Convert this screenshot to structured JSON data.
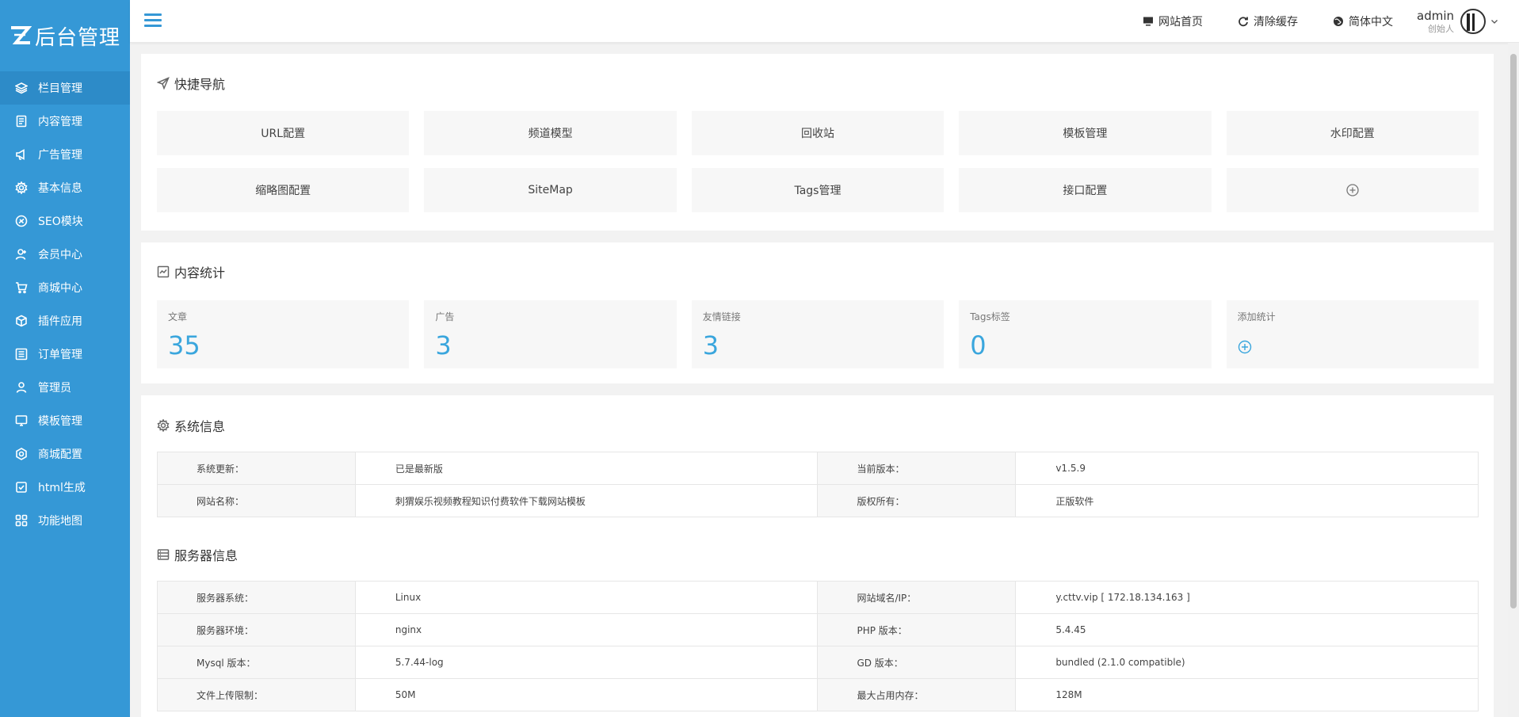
{
  "app": {
    "logo_text": "后台管理",
    "logo_mark": "Z"
  },
  "sidebar": {
    "items": [
      {
        "label": "栏目管理",
        "icon": "layers-icon",
        "active": true
      },
      {
        "label": "内容管理",
        "icon": "document-icon"
      },
      {
        "label": "广告管理",
        "icon": "megaphone-icon"
      },
      {
        "label": "基本信息",
        "icon": "gear-icon"
      },
      {
        "label": "SEO模块",
        "icon": "seo-icon"
      },
      {
        "label": "会员中心",
        "icon": "user-icon"
      },
      {
        "label": "商城中心",
        "icon": "cart-icon"
      },
      {
        "label": "插件应用",
        "icon": "cube-icon"
      },
      {
        "label": "订单管理",
        "icon": "list-icon"
      },
      {
        "label": "管理员",
        "icon": "person-icon"
      },
      {
        "label": "模板管理",
        "icon": "monitor-icon"
      },
      {
        "label": "商城配置",
        "icon": "hexagon-gear-icon"
      },
      {
        "label": "html生成",
        "icon": "checkbox-icon"
      },
      {
        "label": "功能地图",
        "icon": "grid-icon"
      }
    ]
  },
  "header": {
    "links": [
      {
        "label": "网站首页",
        "icon": "monitor-icon"
      },
      {
        "label": "清除缓存",
        "icon": "refresh-icon"
      },
      {
        "label": "简体中文",
        "icon": "globe-icon"
      }
    ],
    "user_name": "admin",
    "user_role": "创始人"
  },
  "quick_nav": {
    "title": "快捷导航",
    "buttons": [
      "URL配置",
      "频道模型",
      "回收站",
      "模板管理",
      "水印配置",
      "缩略图配置",
      "SiteMap",
      "Tags管理",
      "接口配置"
    ]
  },
  "content_stats": {
    "title": "内容统计",
    "items": [
      {
        "label": "文章",
        "value": "35"
      },
      {
        "label": "广告",
        "value": "3"
      },
      {
        "label": "友情链接",
        "value": "3"
      },
      {
        "label": "Tags标签",
        "value": "0"
      }
    ],
    "add_label": "添加统计"
  },
  "system_info": {
    "title": "系统信息",
    "rows": [
      {
        "k1": "系统更新：",
        "v1": "已是最新版",
        "k2": "当前版本：",
        "v2": "v1.5.9"
      },
      {
        "k1": "网站名称：",
        "v1": "刺猬娱乐视频教程知识付费软件下载网站模板",
        "k2": "版权所有：",
        "v2": "正版软件"
      }
    ]
  },
  "server_info": {
    "title": "服务器信息",
    "rows": [
      {
        "k1": "服务器系统：",
        "v1": "Linux",
        "k2": "网站域名/IP：",
        "v2": "y.cttv.vip [ 172.18.134.163 ]"
      },
      {
        "k1": "服务器环境：",
        "v1": "nginx",
        "k2": "PHP 版本：",
        "v2": "5.4.45"
      },
      {
        "k1": "Mysql 版本：",
        "v1": "5.7.44-log",
        "k2": "GD 版本：",
        "v2": "bundled (2.1.0 compatible)"
      },
      {
        "k1": "文件上传限制：",
        "v1": "50M",
        "k2": "最大占用内存：",
        "v2": "128M"
      }
    ]
  },
  "colors": {
    "sidebar_bg": "#3598d6",
    "accent": "#3aa6dd"
  }
}
